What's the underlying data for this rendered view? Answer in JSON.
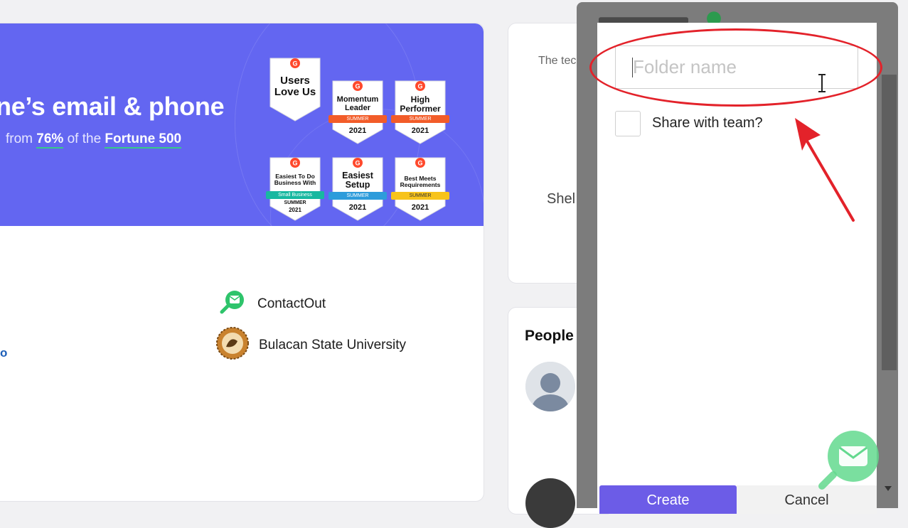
{
  "banner": {
    "headline": "ne’s email & phone",
    "sub_prefix": "from",
    "sub_pct": "76%",
    "sub_mid": "of the",
    "sub_fortune": "Fortune 500",
    "badges": [
      {
        "title": "Users Love Us",
        "ribbon": "",
        "year": ""
      },
      {
        "title": "Momentum Leader",
        "ribbon": "SUMMER",
        "year": "2021"
      },
      {
        "title": "High Performer",
        "ribbon": "SUMMER",
        "year": "2021"
      },
      {
        "title": "Easiest To Do Business With",
        "ribbon": "Small Business",
        "season": "SUMMER",
        "year": "2021"
      },
      {
        "title": "Easiest Setup",
        "ribbon": "SUMMER",
        "year": "2021"
      },
      {
        "title": "Best Meets Requirements",
        "ribbon": "SUMMER",
        "year": "2021"
      }
    ],
    "colors": {
      "background": "#6366f1",
      "underline": "#38c98a",
      "ribbon_orange": "#f25c29",
      "ribbon_teal": "#18b8a0",
      "ribbon_blue": "#2d9cdb",
      "ribbon_yellow": "#f7c31b"
    }
  },
  "companies": [
    {
      "name": "ContactOut",
      "icon": "contactout-logo-icon"
    },
    {
      "name": "Bulacan State University",
      "icon": "university-seal-icon"
    }
  ],
  "link_fragment": "o",
  "side": {
    "card1_text": "The tec",
    "card1_name": "Shel",
    "people_title": "People"
  },
  "modal": {
    "folder_placeholder": "Folder name",
    "share_label": "Share with team?",
    "create_label": "Create",
    "cancel_label": "Cancel"
  },
  "annotation": {
    "color": "#e3222a"
  }
}
